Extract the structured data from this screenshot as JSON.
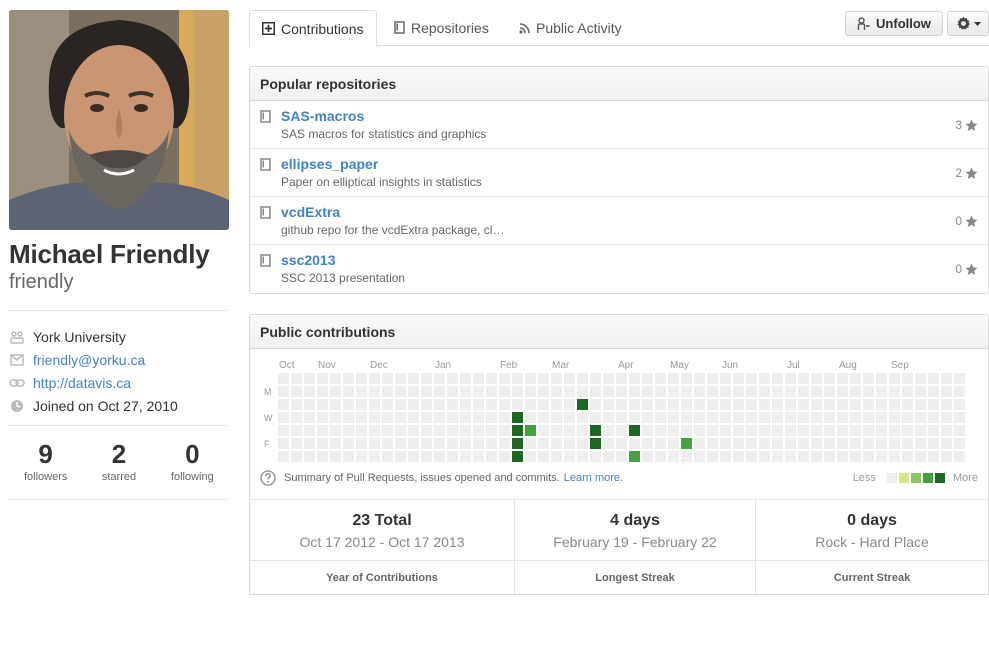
{
  "profile": {
    "fullname": "Michael Friendly",
    "username": "friendly",
    "organization": "York University",
    "email": "friendly@yorku.ca",
    "website": "http://datavis.ca",
    "joined": "Joined on Oct 27, 2010",
    "icons": {
      "org": "organization-icon",
      "email": "mail-icon",
      "link": "link-icon",
      "clock": "clock-icon"
    }
  },
  "stats": [
    {
      "num": "9",
      "label": "followers"
    },
    {
      "num": "2",
      "label": "starred"
    },
    {
      "num": "0",
      "label": "following"
    }
  ],
  "tabs": {
    "contributions": "Contributions",
    "repositories": "Repositories",
    "activity": "Public Activity"
  },
  "actions": {
    "unfollow": "Unfollow"
  },
  "popular": {
    "title": "Popular repositories",
    "repos": [
      {
        "name": "SAS-macros",
        "desc": "SAS macros for statistics and graphics",
        "stars": "3"
      },
      {
        "name": "ellipses_paper",
        "desc": "Paper on elliptical insights in statistics",
        "stars": "2"
      },
      {
        "name": "vcdExtra",
        "desc": "github repo for the vcdExtra package, cl…",
        "stars": "0"
      },
      {
        "name": "ssc2013",
        "desc": "SSC 2013 presentation",
        "stars": "0"
      }
    ]
  },
  "contributions": {
    "title": "Public contributions",
    "months": [
      "Oct",
      "Nov",
      "Dec",
      "Jan",
      "Feb",
      "Mar",
      "Apr",
      "May",
      "Jun",
      "Jul",
      "Aug",
      "Sep"
    ],
    "day_labels": [
      "M",
      "W",
      "F"
    ],
    "weeks": 53,
    "active_cells": [
      {
        "week": 18,
        "day": 3,
        "level": 4
      },
      {
        "week": 18,
        "day": 4,
        "level": 4
      },
      {
        "week": 18,
        "day": 5,
        "level": 4
      },
      {
        "week": 18,
        "day": 6,
        "level": 4
      },
      {
        "week": 19,
        "day": 4,
        "level": 3
      },
      {
        "week": 23,
        "day": 2,
        "level": 4
      },
      {
        "week": 24,
        "day": 4,
        "level": 4
      },
      {
        "week": 24,
        "day": 5,
        "level": 4
      },
      {
        "week": 27,
        "day": 4,
        "level": 4
      },
      {
        "week": 27,
        "day": 6,
        "level": 3
      },
      {
        "week": 31,
        "day": 5,
        "level": 3
      }
    ],
    "colors": {
      "empty": "#eeeeee",
      "l1": "#d6e685",
      "l2": "#8cc665",
      "l3": "#44a340",
      "l4": "#1e6823"
    },
    "note": "Summary of Pull Requests, issues opened and commits.",
    "learn_more": "Learn more.",
    "legend_less": "Less",
    "legend_more": "More"
  },
  "summary": [
    {
      "big": "23 Total",
      "sub": "Oct 17 2012 - Oct 17 2013",
      "cap": "Year of Contributions"
    },
    {
      "big": "4 days",
      "sub": "February 19 - February 22",
      "cap": "Longest Streak"
    },
    {
      "big": "0 days",
      "sub": "Rock - Hard Place",
      "cap": "Current Streak"
    }
  ]
}
